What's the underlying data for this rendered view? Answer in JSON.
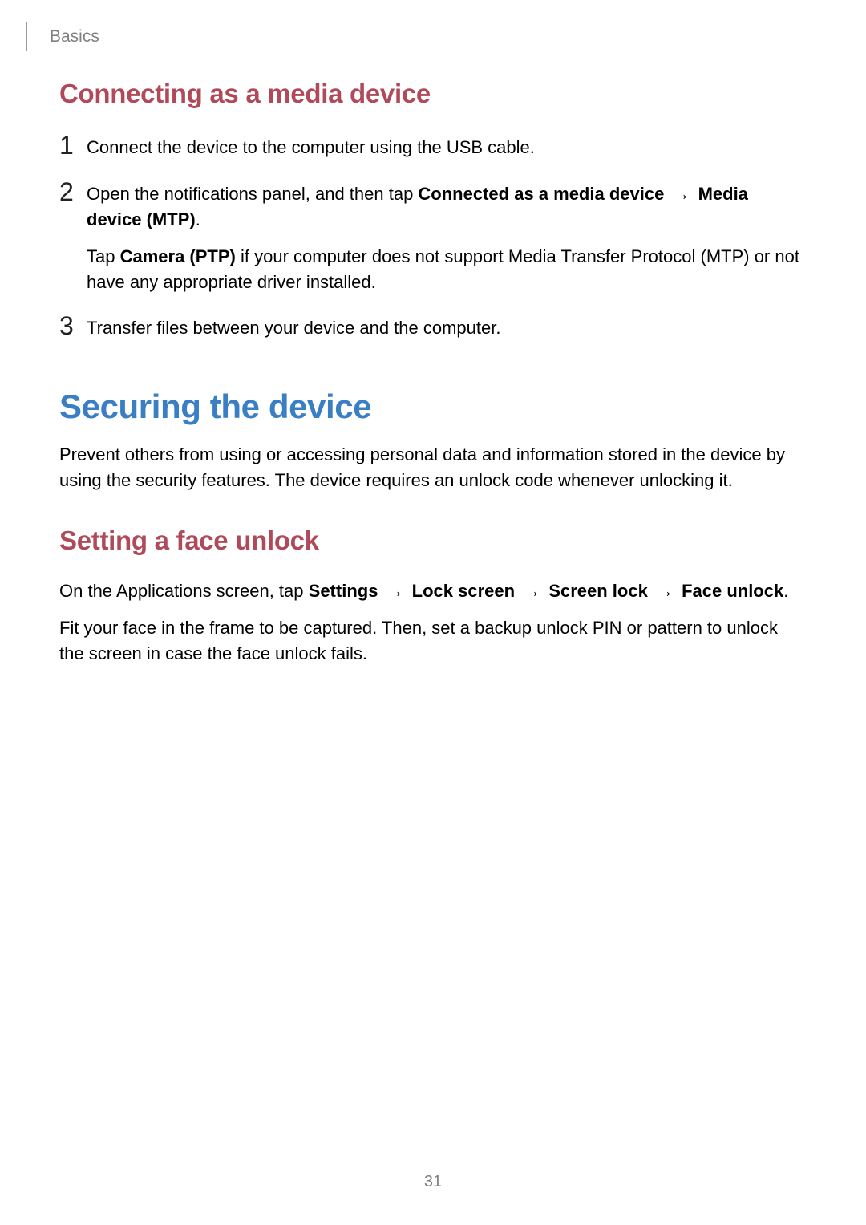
{
  "header": {
    "section": "Basics"
  },
  "section1": {
    "heading": "Connecting as a media device",
    "steps": [
      {
        "num": "1",
        "parts": [
          {
            "t": "Connect the device to the computer using the USB cable."
          }
        ]
      },
      {
        "num": "2",
        "parts": [
          {
            "t": "Open the notifications panel, and then tap "
          },
          {
            "t": "Connected as a media device",
            "b": true
          },
          {
            "t": " → ",
            "arrow": true
          },
          {
            "t": "Media device (MTP)",
            "b": true
          },
          {
            "t": "."
          }
        ],
        "extra": [
          {
            "t": "Tap "
          },
          {
            "t": "Camera (PTP)",
            "b": true
          },
          {
            "t": " if your computer does not support Media Transfer Protocol (MTP) or not have any appropriate driver installed."
          }
        ]
      },
      {
        "num": "3",
        "parts": [
          {
            "t": "Transfer files between your device and the computer."
          }
        ]
      }
    ]
  },
  "section2": {
    "heading": "Securing the device",
    "intro": "Prevent others from using or accessing personal data and information stored in the device by using the security features. The device requires an unlock code whenever unlocking it."
  },
  "section3": {
    "heading": "Setting a face unlock",
    "line1": [
      {
        "t": "On the Applications screen, tap "
      },
      {
        "t": "Settings",
        "b": true
      },
      {
        "t": " → ",
        "arrow": true
      },
      {
        "t": "Lock screen",
        "b": true
      },
      {
        "t": " → ",
        "arrow": true
      },
      {
        "t": "Screen lock",
        "b": true
      },
      {
        "t": " → ",
        "arrow": true
      },
      {
        "t": "Face unlock",
        "b": true
      },
      {
        "t": "."
      }
    ],
    "line2": "Fit your face in the frame to be captured. Then, set a backup unlock PIN or pattern to unlock the screen in case the face unlock fails."
  },
  "page_number": "31"
}
